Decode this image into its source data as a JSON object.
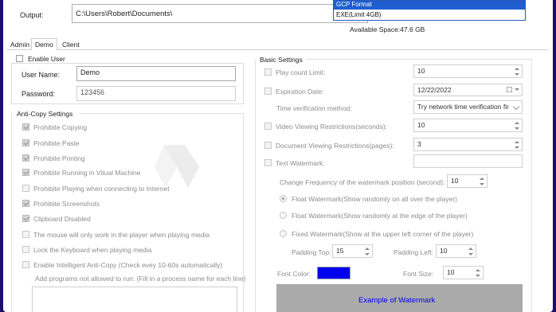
{
  "top": {
    "output_label": "Output:",
    "output_path": "C:\\Users\\Robert\\Documents\\",
    "format_options": [
      "GCP Format",
      "EXE(Limit 4GB)"
    ],
    "available_space": "Available Space:47.6 GB"
  },
  "tabs": [
    "Admin",
    "Demo",
    "Client"
  ],
  "left": {
    "enable_user_label": "Enable User",
    "user_name_label": "User Name:",
    "user_name_value": "Demo",
    "password_label": "Password:",
    "password_value": "123456",
    "anticopy_title": "Anti-Copy Settings",
    "options": [
      "Prohibite Copying",
      "Prohibite Paste",
      "Prohibite Printing",
      "Prohibite Running in Vitual Machine",
      "Prohibite Playing when connecting to Internet",
      "Prohibite Screenshots",
      "Clipboard Disabled",
      "The mouse will only work in the player when playing media",
      "Lock the Keyboard when playing media",
      "Enable Intelligent Anti-Copy (Check evey 10-60s automatically)"
    ],
    "programs_note": "Add programs not allowed to run: (Fill in a process name for each line)"
  },
  "right": {
    "basic_title": "Basic Settings",
    "play_count_label": "Play count Limit:",
    "play_count_value": "10",
    "expiration_label": "Expiration Date:",
    "expiration_value": "12/22/2022",
    "time_method_label": "Time verification method:",
    "time_method_value": "Try network time verification fir",
    "video_restrict_label": "Video Viewing Restrictions(seconds):",
    "video_restrict_value": "10",
    "doc_restrict_label": "Document Viewing Restrictions(pages):",
    "doc_restrict_value": "3",
    "text_watermark_label": "Text Watermark:",
    "text_watermark_value": "",
    "frequency_label": "Change Frequency of the watermark position (second):",
    "frequency_value": "10",
    "radio_float_all": "Float Watermark(Show randomly on all over the player)",
    "radio_float_edge": "Float Watermark(Show randomly at the edge of the player)",
    "radio_fixed": "Fixed Watermark(Show at the upper left corner of the player)",
    "padding_top_label": "Padding Top:",
    "padding_top_value": "15",
    "padding_left_label": "Padding Left:",
    "padding_left_value": "10",
    "font_color_label": "Font Color:",
    "font_color": "#0000ee",
    "font_size_label": "Font Size:",
    "font_size_value": "10",
    "watermark_example": "Example of Watermark"
  },
  "colors": {
    "background": "#1a0f6e",
    "selection": "#1f5fd0",
    "watermark_text": "#0000ee"
  }
}
